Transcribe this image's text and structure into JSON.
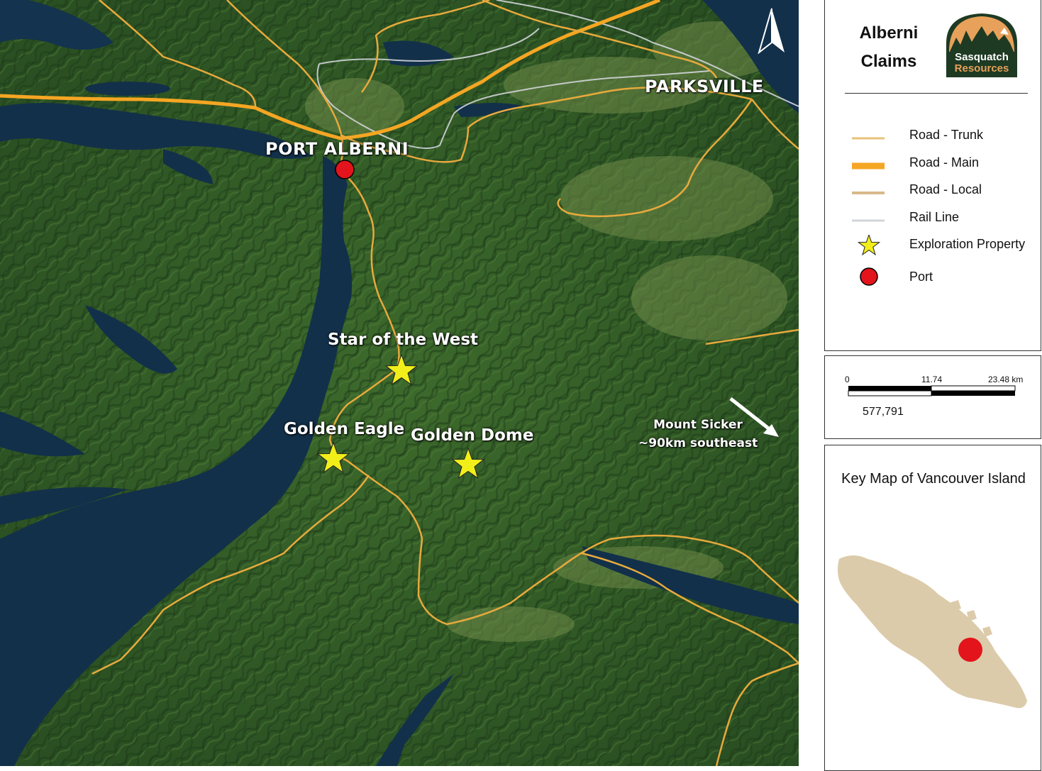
{
  "map": {
    "towns": {
      "port_alberni": "PORT ALBERNI",
      "parksville": "PARKSVILLE"
    },
    "properties": {
      "star_of_the_west": "Star of the West",
      "golden_eagle": "Golden Eagle",
      "golden_dome": "Golden Dome"
    },
    "annotation": {
      "line1": "Mount Sicker",
      "line2": "~90km southeast"
    }
  },
  "legend": {
    "title_line1": "Alberni",
    "title_line2": "Claims",
    "logo_line1": "Sasquatch",
    "logo_line2": "Resources",
    "items": [
      {
        "label": "Road - Trunk",
        "symbol": "thin-orange-line"
      },
      {
        "label": "Road - Main",
        "symbol": "thick-orange-line"
      },
      {
        "label": "Road - Local",
        "symbol": "tan-line"
      },
      {
        "label": "Rail Line",
        "symbol": "gray-line"
      },
      {
        "label": "Exploration Property",
        "symbol": "star-icon"
      },
      {
        "label": "Port",
        "symbol": "red-dot-icon"
      }
    ]
  },
  "scale_bar": {
    "tick_0": "0",
    "tick_1": "11.74",
    "tick_2": "23.48 km",
    "ratio": "577,791"
  },
  "key_map": {
    "title": "Key Map of Vancouver Island"
  },
  "colors": {
    "road_main": "#F5A623",
    "road_trunk": "#E8C27A",
    "road_local": "#D9B98A",
    "rail": "#D0D4D8",
    "star": "#F2EE1A",
    "port": "#E3141B",
    "island": "#DCCBAA",
    "logo_brand": "#1E3A23",
    "logo_sun": "#E8A15A"
  }
}
